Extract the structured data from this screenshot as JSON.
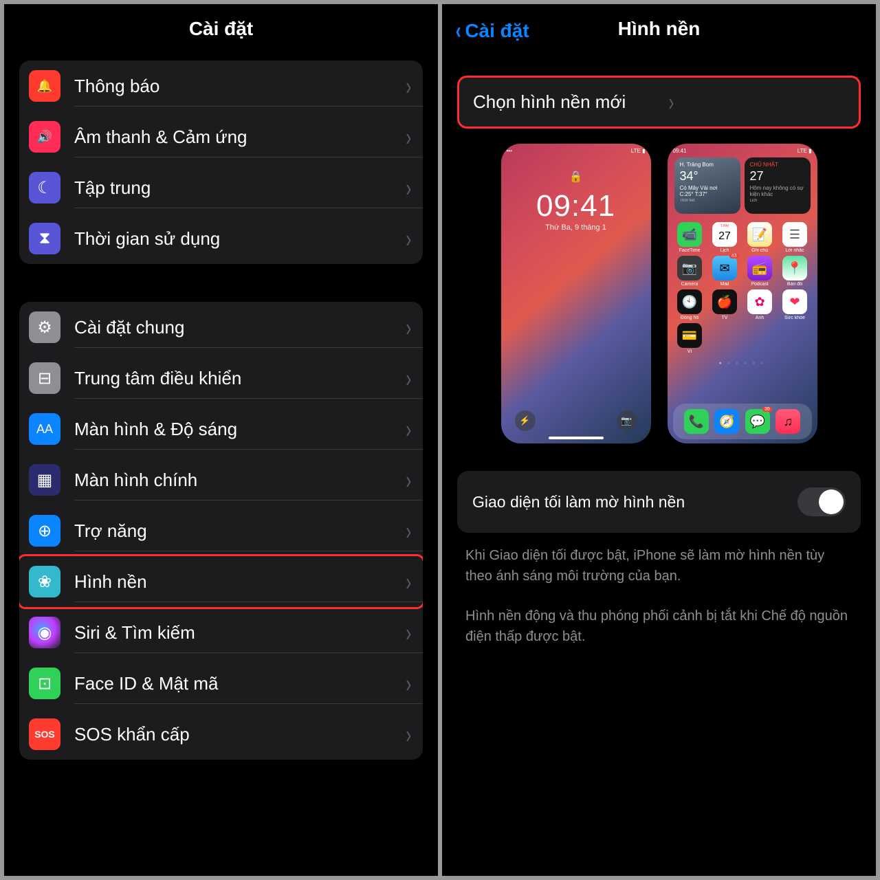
{
  "left": {
    "title": "Cài đặt",
    "group1": [
      {
        "label": "Thông báo",
        "iconClass": "ic-notif",
        "glyph": "🔔",
        "name": "notifications"
      },
      {
        "label": "Âm thanh & Cảm ứng",
        "iconClass": "ic-sound",
        "glyph": "🔊",
        "name": "sounds"
      },
      {
        "label": "Tập trung",
        "iconClass": "ic-focus",
        "glyph": "☾",
        "name": "focus"
      },
      {
        "label": "Thời gian sử dụng",
        "iconClass": "ic-screen",
        "glyph": "⧗",
        "name": "screentime"
      }
    ],
    "group2": [
      {
        "label": "Cài đặt chung",
        "iconClass": "ic-general",
        "glyph": "⚙",
        "name": "general"
      },
      {
        "label": "Trung tâm điều khiển",
        "iconClass": "ic-control",
        "glyph": "⊟",
        "name": "control-center"
      },
      {
        "label": "Màn hình & Độ sáng",
        "iconClass": "ic-display",
        "glyph": "AA",
        "name": "display"
      },
      {
        "label": "Màn hình chính",
        "iconClass": "ic-home",
        "glyph": "▦",
        "name": "home-screen"
      },
      {
        "label": "Trợ năng",
        "iconClass": "ic-access",
        "glyph": "⊕",
        "name": "accessibility"
      },
      {
        "label": "Hình nền",
        "iconClass": "ic-wall",
        "glyph": "❀",
        "name": "wallpaper",
        "highlight": true
      },
      {
        "label": "Siri & Tìm kiếm",
        "iconClass": "ic-siri",
        "glyph": "◉",
        "name": "siri"
      },
      {
        "label": "Face ID & Mật mã",
        "iconClass": "ic-face",
        "glyph": "⊡",
        "name": "faceid"
      },
      {
        "label": "SOS khẩn cấp",
        "iconClass": "ic-sos",
        "glyph": "SOS",
        "name": "sos"
      }
    ]
  },
  "right": {
    "back": "Cài đặt",
    "title": "Hình nền",
    "choose": "Chọn hình nền mới",
    "lock": {
      "time": "09:41",
      "date": "Thứ Ba, 9 tháng 1"
    },
    "weather": {
      "loc": "H. Trảng Bom",
      "temp": "34°",
      "cond": "Có Mây Vài nơi",
      "range": "C:25° T:37°"
    },
    "cal": {
      "day": "CHỦ NHẬT",
      "num": "27",
      "note": "Hôm nay không có sự kiện khác"
    },
    "apps": [
      {
        "lbl": "FaceTime",
        "bg": "#30d158",
        "g": "📹"
      },
      {
        "lbl": "Lịch",
        "bg": "#fff",
        "g": "27",
        "text": "#000",
        "top": "T.HAI"
      },
      {
        "lbl": "Ghi chú",
        "bg": "linear-gradient(#fff,#ffe680)",
        "g": "📝"
      },
      {
        "lbl": "Lời nhắc",
        "bg": "#fff",
        "g": "☰",
        "text": "#555"
      },
      {
        "lbl": "Camera",
        "bg": "#3a3a3a",
        "g": "📷"
      },
      {
        "lbl": "Mail",
        "bg": "linear-gradient(#4fc3f7,#1e88e5)",
        "g": "✉",
        "badge": "43"
      },
      {
        "lbl": "Podcast",
        "bg": "linear-gradient(#b34aff,#7a1fd0)",
        "g": "📻"
      },
      {
        "lbl": "Bản đồ",
        "bg": "linear-gradient(#5ee0a0,#fff)",
        "g": "📍"
      },
      {
        "lbl": "Đồng hồ",
        "bg": "#111",
        "g": "🕙"
      },
      {
        "lbl": "TV",
        "bg": "#111",
        "g": "🍎"
      },
      {
        "lbl": "Ảnh",
        "bg": "#fff",
        "g": "✿",
        "text": "#e06"
      },
      {
        "lbl": "Sức khỏe",
        "bg": "#fff",
        "g": "❤",
        "text": "#ff2d55"
      },
      {
        "lbl": "Ví",
        "bg": "#111",
        "g": "💳"
      }
    ],
    "dock": [
      {
        "bg": "#30d158",
        "g": "📞"
      },
      {
        "bg": "#0a84ff",
        "g": "🧭"
      },
      {
        "bg": "#30d158",
        "g": "💬",
        "badge": "39"
      },
      {
        "bg": "linear-gradient(#ff5a7a,#ff2d55)",
        "g": "♫"
      }
    ],
    "dimLabel": "Giao diện tối làm mờ hình nền",
    "footer1": "Khi Giao diện tối được bật, iPhone sẽ làm mờ hình nền tùy theo ánh sáng môi trường của bạn.",
    "footer2": "Hình nền động và thu phóng phối cảnh bị tắt khi Chế độ nguồn điện thấp được bật."
  }
}
